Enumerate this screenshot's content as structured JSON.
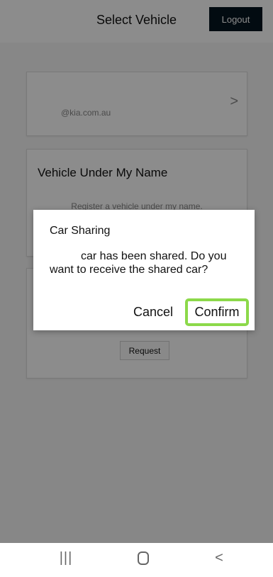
{
  "header": {
    "title": "Select Vehicle",
    "logout_label": "Logout"
  },
  "account_card": {
    "email": "@kia.com.au",
    "chevron": ">"
  },
  "vehicle_card": {
    "title": "Vehicle Under My Name",
    "subtitle": "Register a vehicle under my name."
  },
  "share_card": {
    "request_label": "Request"
  },
  "dialog": {
    "title": "Car Sharing",
    "message": "car has been shared. Do you want to receive the shared car?",
    "cancel_label": "Cancel",
    "confirm_label": "Confirm",
    "highlight_color": "#8cd94a"
  },
  "navbar": {
    "recents_icon": "recents-icon",
    "home_icon": "home-icon",
    "back_icon": "back-icon",
    "recents_glyph": "|||",
    "back_glyph": "<"
  }
}
